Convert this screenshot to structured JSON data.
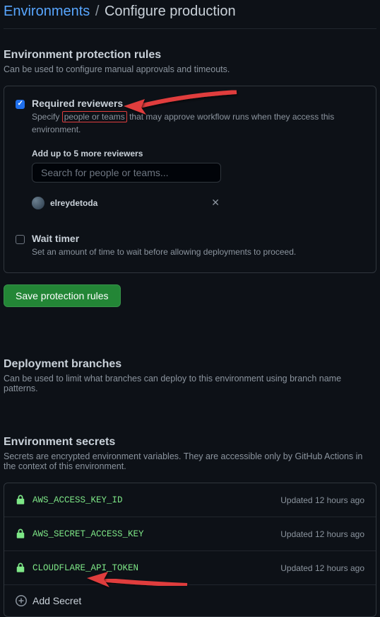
{
  "breadcrumb": {
    "environments": "Environments",
    "separator": "/",
    "current": "Configure production"
  },
  "protection": {
    "title": "Environment protection rules",
    "subtitle": "Can be used to configure manual approvals and timeouts.",
    "required_reviewers": {
      "label": "Required reviewers",
      "desc_before": "Specify ",
      "desc_highlight": "people or teams",
      "desc_after": " that may approve workflow runs when they access this environment.",
      "add_up": "Add up to 5 more reviewers",
      "search_placeholder": "Search for people or teams...",
      "reviewer_name": "elreydetoda"
    },
    "wait_timer": {
      "label": "Wait timer",
      "desc": "Set an amount of time to wait before allowing deployments to proceed."
    },
    "save_button": "Save protection rules"
  },
  "branches": {
    "title": "Deployment branches",
    "subtitle": "Can be used to limit what branches can deploy to this environment using branch name patterns."
  },
  "secrets": {
    "title": "Environment secrets",
    "subtitle": "Secrets are encrypted environment variables. They are accessible only by GitHub Actions in the context of this environment.",
    "items": [
      {
        "name": "AWS_ACCESS_KEY_ID",
        "updated": "Updated 12 hours ago"
      },
      {
        "name": "AWS_SECRET_ACCESS_KEY",
        "updated": "Updated 12 hours ago"
      },
      {
        "name": "CLOUDFLARE_API_TOKEN",
        "updated": "Updated 12 hours ago"
      }
    ],
    "add_label": "Add Secret"
  }
}
